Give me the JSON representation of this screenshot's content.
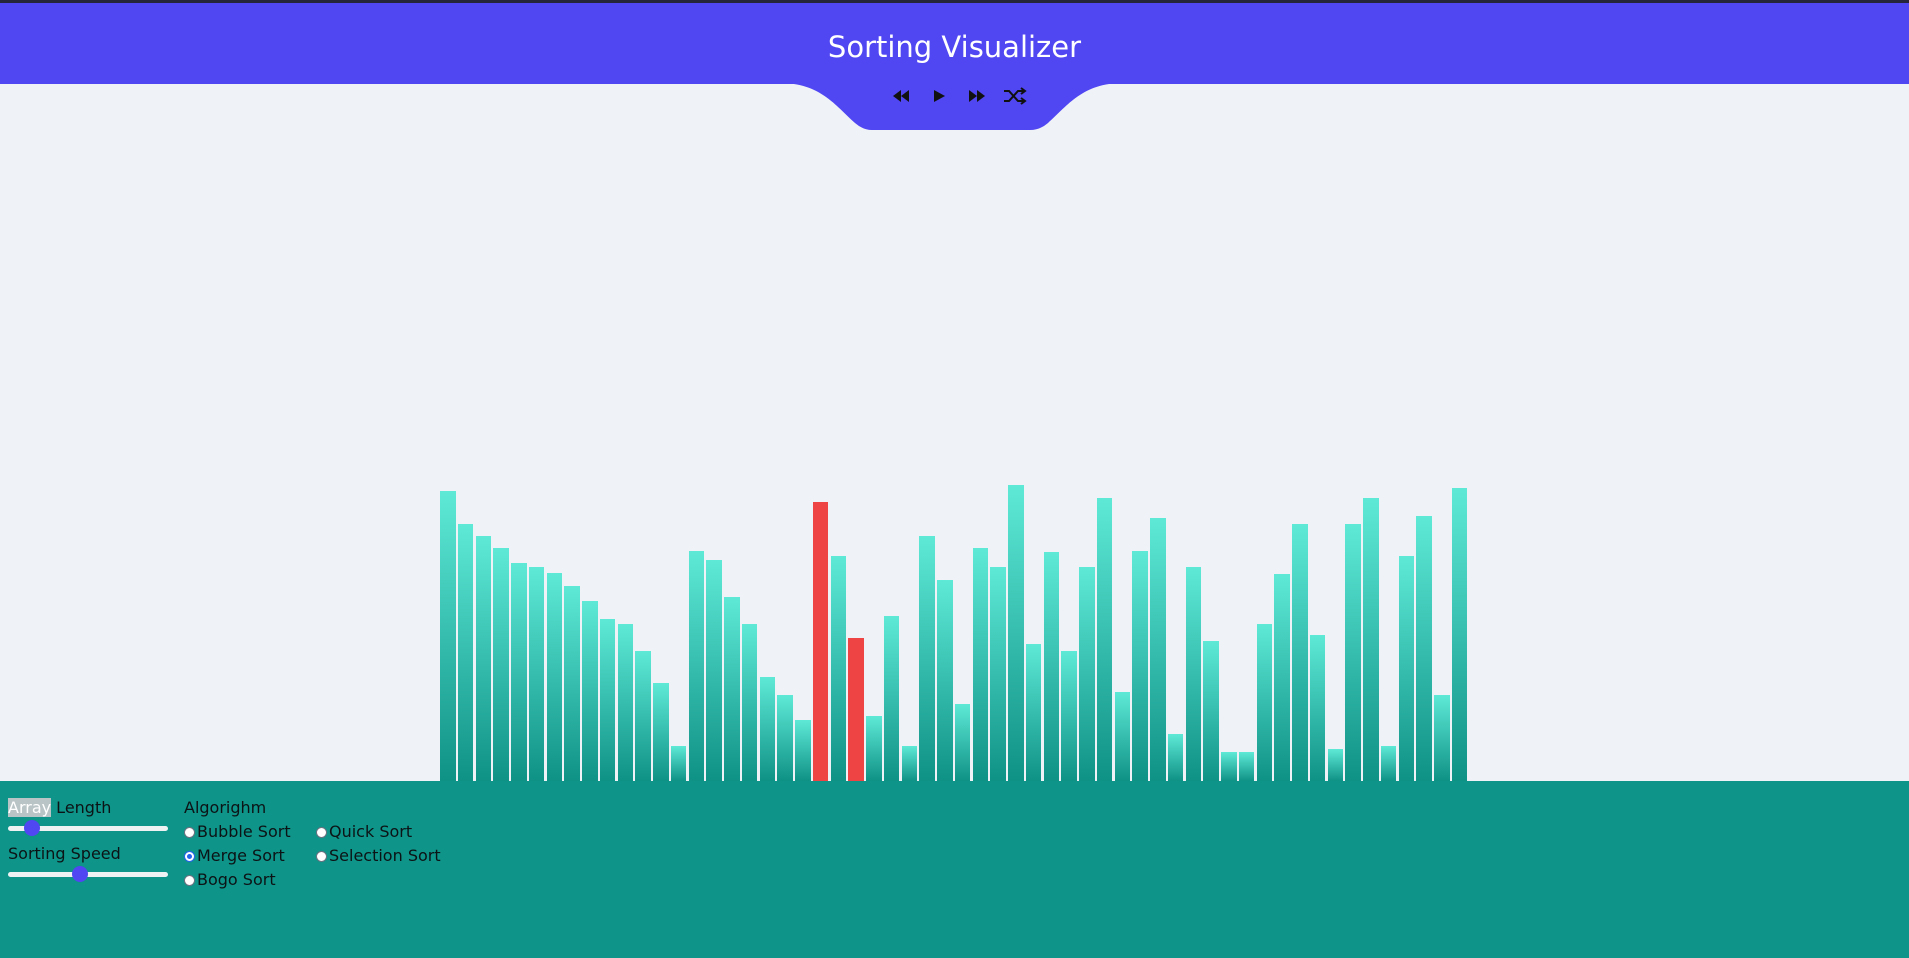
{
  "app": {
    "title": "Sorting Visualizer",
    "colors": {
      "header": "#5046f2",
      "background": "#eff3f8",
      "footer": "#0e9488",
      "bar_top": "#5ee9d6",
      "bar_bottom": "#0f9286",
      "bar_active": "#ef4444",
      "slider_thumb": "#5046f2"
    }
  },
  "controls": [
    {
      "name": "rewind-icon",
      "icon": "double-left-triangle"
    },
    {
      "name": "play-icon",
      "icon": "right-triangle"
    },
    {
      "name": "fast-forward-icon",
      "icon": "double-right-triangle"
    },
    {
      "name": "shuffle-icon",
      "icon": "crossed-arrows"
    }
  ],
  "settings": {
    "array_length": {
      "label_highlight": "Array",
      "label_rest": " Length",
      "value": 0.15
    },
    "sorting_speed": {
      "label": "Sorting Speed",
      "value": 0.45
    }
  },
  "algorithm": {
    "label": "Algorighm",
    "options": [
      {
        "label": "Bubble Sort",
        "selected": false
      },
      {
        "label": "Quick Sort",
        "selected": false
      },
      {
        "label": "Merge Sort",
        "selected": true
      },
      {
        "label": "Selection Sort",
        "selected": false
      },
      {
        "label": "Bogo Sort",
        "selected": false
      }
    ]
  },
  "bars": {
    "values": [
      290,
      257,
      245,
      233,
      218,
      214,
      208,
      195,
      180,
      162,
      157,
      130,
      98,
      35,
      230,
      221,
      184,
      157,
      104,
      86,
      61,
      279,
      225,
      143,
      65,
      165,
      35,
      245,
      201,
      77,
      233,
      214,
      296,
      137,
      229,
      130,
      214,
      283,
      89,
      230,
      263,
      47,
      214,
      140,
      29,
      29,
      157,
      207,
      257,
      146,
      32,
      257,
      283,
      35,
      225,
      265,
      86,
      293
    ],
    "active": [
      21,
      23
    ]
  }
}
